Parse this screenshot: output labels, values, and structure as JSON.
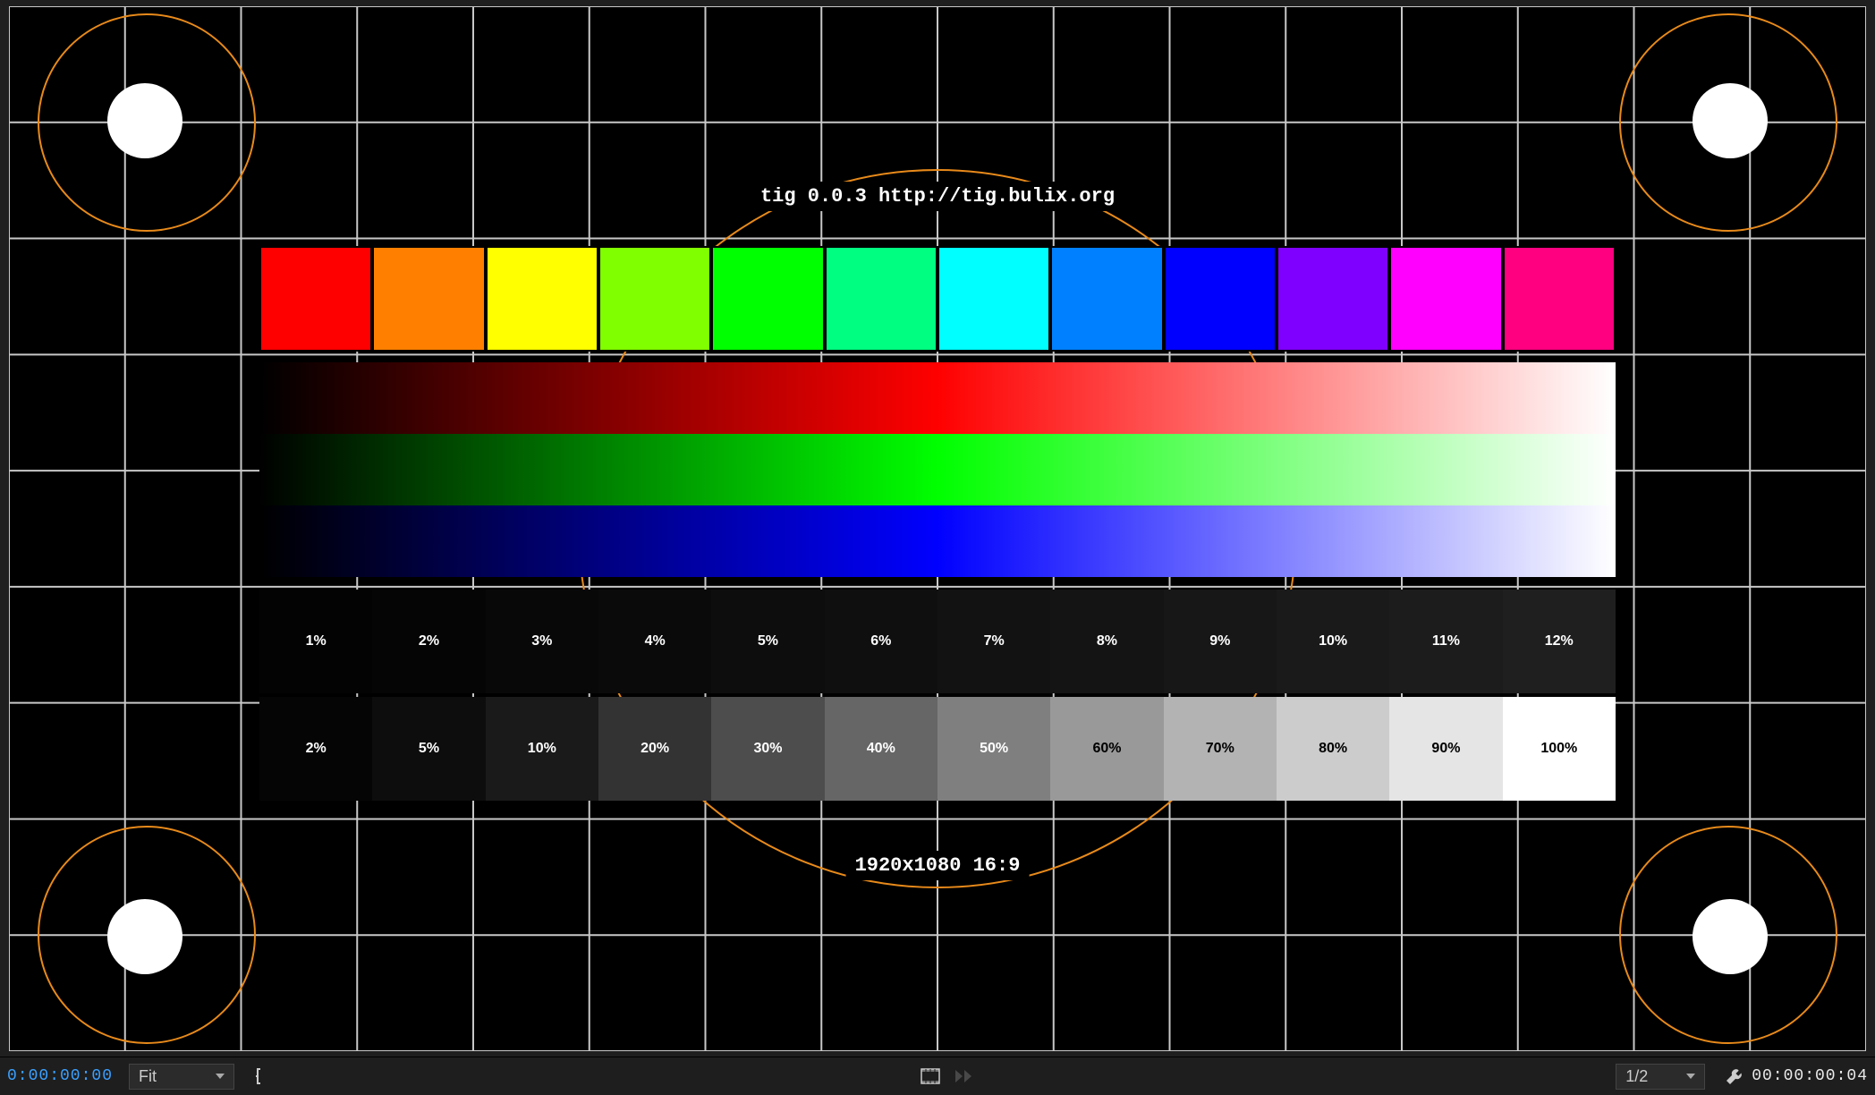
{
  "test_pattern": {
    "title_line": "tig 0.0.3  http://tig.bulix.org",
    "footer_line": "1920x1080  16:9",
    "colors": [
      "#ff0000",
      "#ff7f00",
      "#ffff00",
      "#80ff00",
      "#00ff00",
      "#00ff80",
      "#00ffff",
      "#0080ff",
      "#0000ff",
      "#8000ff",
      "#ff00ff",
      "#ff0080"
    ],
    "gradients": [
      "#ff0000",
      "#00ff00",
      "#0000ff"
    ],
    "steps_dark": {
      "labels": [
        "1%",
        "2%",
        "3%",
        "4%",
        "5%",
        "6%",
        "7%",
        "8%",
        "9%",
        "10%",
        "11%",
        "12%"
      ],
      "pct": [
        1,
        2,
        3,
        4,
        5,
        6,
        7,
        8,
        9,
        10,
        11,
        12
      ]
    },
    "steps_light": {
      "labels": [
        "2%",
        "5%",
        "10%",
        "20%",
        "30%",
        "40%",
        "50%",
        "60%",
        "70%",
        "80%",
        "90%",
        "100%"
      ],
      "pct": [
        2,
        5,
        10,
        20,
        30,
        40,
        50,
        60,
        70,
        80,
        90,
        100
      ]
    }
  },
  "toolbar": {
    "timecode_left": "0:00:00:00",
    "fit_label": "Fit",
    "resolution_label": "1/2",
    "timecode_right": "00:00:00:04"
  },
  "chart_data": {
    "type": "table",
    "title": "Test Pattern",
    "resolution": "1920x1080",
    "aspect": "16:9",
    "color_swatches_hex": [
      "#ff0000",
      "#ff7f00",
      "#ffff00",
      "#80ff00",
      "#00ff00",
      "#00ff80",
      "#00ffff",
      "#0080ff",
      "#0000ff",
      "#8000ff",
      "#ff00ff",
      "#ff0080"
    ],
    "gradient_channels": [
      "red",
      "green",
      "blue"
    ],
    "dark_steps_pct": [
      1,
      2,
      3,
      4,
      5,
      6,
      7,
      8,
      9,
      10,
      11,
      12
    ],
    "light_steps_pct": [
      2,
      5,
      10,
      20,
      30,
      40,
      50,
      60,
      70,
      80,
      90,
      100
    ]
  }
}
